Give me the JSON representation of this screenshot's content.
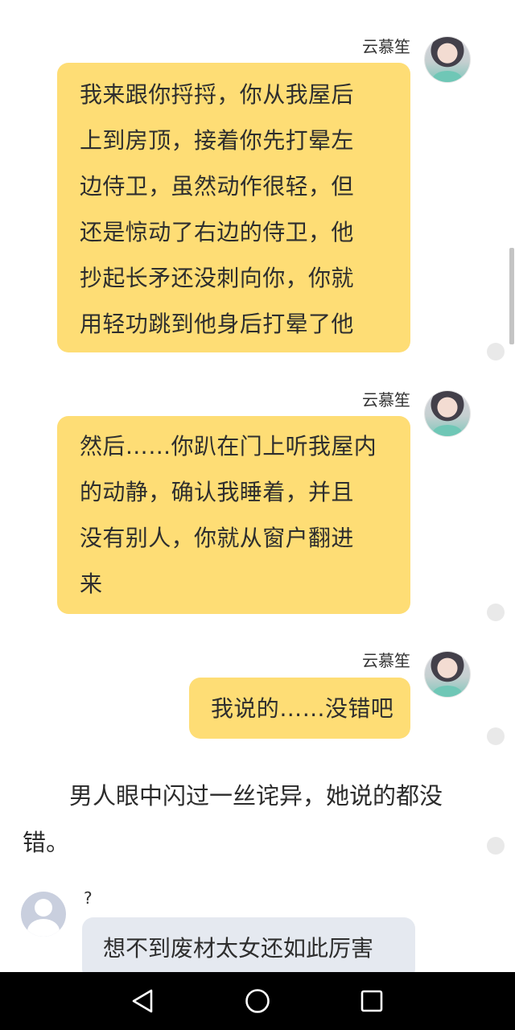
{
  "messages": [
    {
      "sender": "云慕笙",
      "lines": [
        "我来跟你捋捋，你从我屋后",
        "上到房顶，接着你先打晕左",
        "边侍卫，虽然动作很轻，但",
        "还是惊动了右边的侍卫，他",
        "抄起长矛还没刺向你，你就",
        "用轻功跳到他身后打晕了他"
      ]
    },
    {
      "sender": "云慕笙",
      "lines": [
        "然后……你趴在门上听我屋内",
        "的动静，确认我睡着，并且",
        "没有别人，你就从窗户翻进",
        "来"
      ]
    },
    {
      "sender": "云慕笙",
      "lines": [
        "我说的……没错吧"
      ]
    }
  ],
  "narration": "男人眼中闪过一丝诧异，她说的都没错。",
  "reply": {
    "sender": "?",
    "text": "想不到废材太女还如此厉害"
  },
  "colors": {
    "bubble_self": "#fedd75",
    "bubble_other": "#e5e9f0",
    "navbar": "#000000"
  },
  "icons": {
    "nav_back": "triangle-left",
    "nav_home": "circle",
    "nav_recents": "square"
  }
}
